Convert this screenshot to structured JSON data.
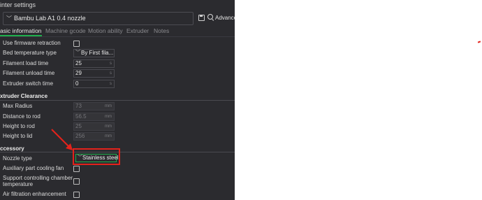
{
  "window": {
    "title": "inter settings"
  },
  "preset": {
    "name": "Bambu Lab A1 0.4 nozzle",
    "advanced_label": "Advanced"
  },
  "tabs": [
    {
      "label": "asic information",
      "active": true
    },
    {
      "label": "Machine gcode",
      "active": false
    },
    {
      "label": "Motion ability",
      "active": false
    },
    {
      "label": "Extruder",
      "active": false
    },
    {
      "label": "Notes",
      "active": false
    }
  ],
  "settings": {
    "firmware_retraction": {
      "label": "Use firmware retraction",
      "checked": false
    },
    "bed_temp_type": {
      "label": "Bed temperature type",
      "value": "By First fila..."
    },
    "filament_load_time": {
      "label": "Filament load time",
      "value": "25",
      "unit": "s"
    },
    "filament_unload_time": {
      "label": "Filament unload time",
      "value": "29",
      "unit": "s"
    },
    "extruder_switch_time": {
      "label": "Extruder switch time",
      "value": "0",
      "unit": "s"
    }
  },
  "extruder_clearance": {
    "heading": "xtruder Clearance",
    "max_radius": {
      "label": "Max Radius",
      "value": "73",
      "unit": "mm"
    },
    "distance_to_rod": {
      "label": "Distance to rod",
      "value": "56.5",
      "unit": "mm"
    },
    "height_to_rod": {
      "label": "Height to rod",
      "value": "25",
      "unit": "mm"
    },
    "height_to_lid": {
      "label": "Height to lid",
      "value": "256",
      "unit": "mm"
    }
  },
  "accessory": {
    "heading": "ccessory",
    "nozzle_type": {
      "label": "Nozzle type",
      "value": "Stainless steel"
    },
    "aux_fan": {
      "label": "Auxiliary part cooling fan",
      "checked": false
    },
    "chamber_temp": {
      "label_line1": "Support controlling chamber",
      "label_line2": "temperature",
      "checked": false
    },
    "air_filtration": {
      "label": "Air filtration enhancement",
      "checked": false
    }
  },
  "colors": {
    "accent": "#1fb04d",
    "annotation": "#e3221b",
    "panel_bg": "#2b2b2f"
  }
}
